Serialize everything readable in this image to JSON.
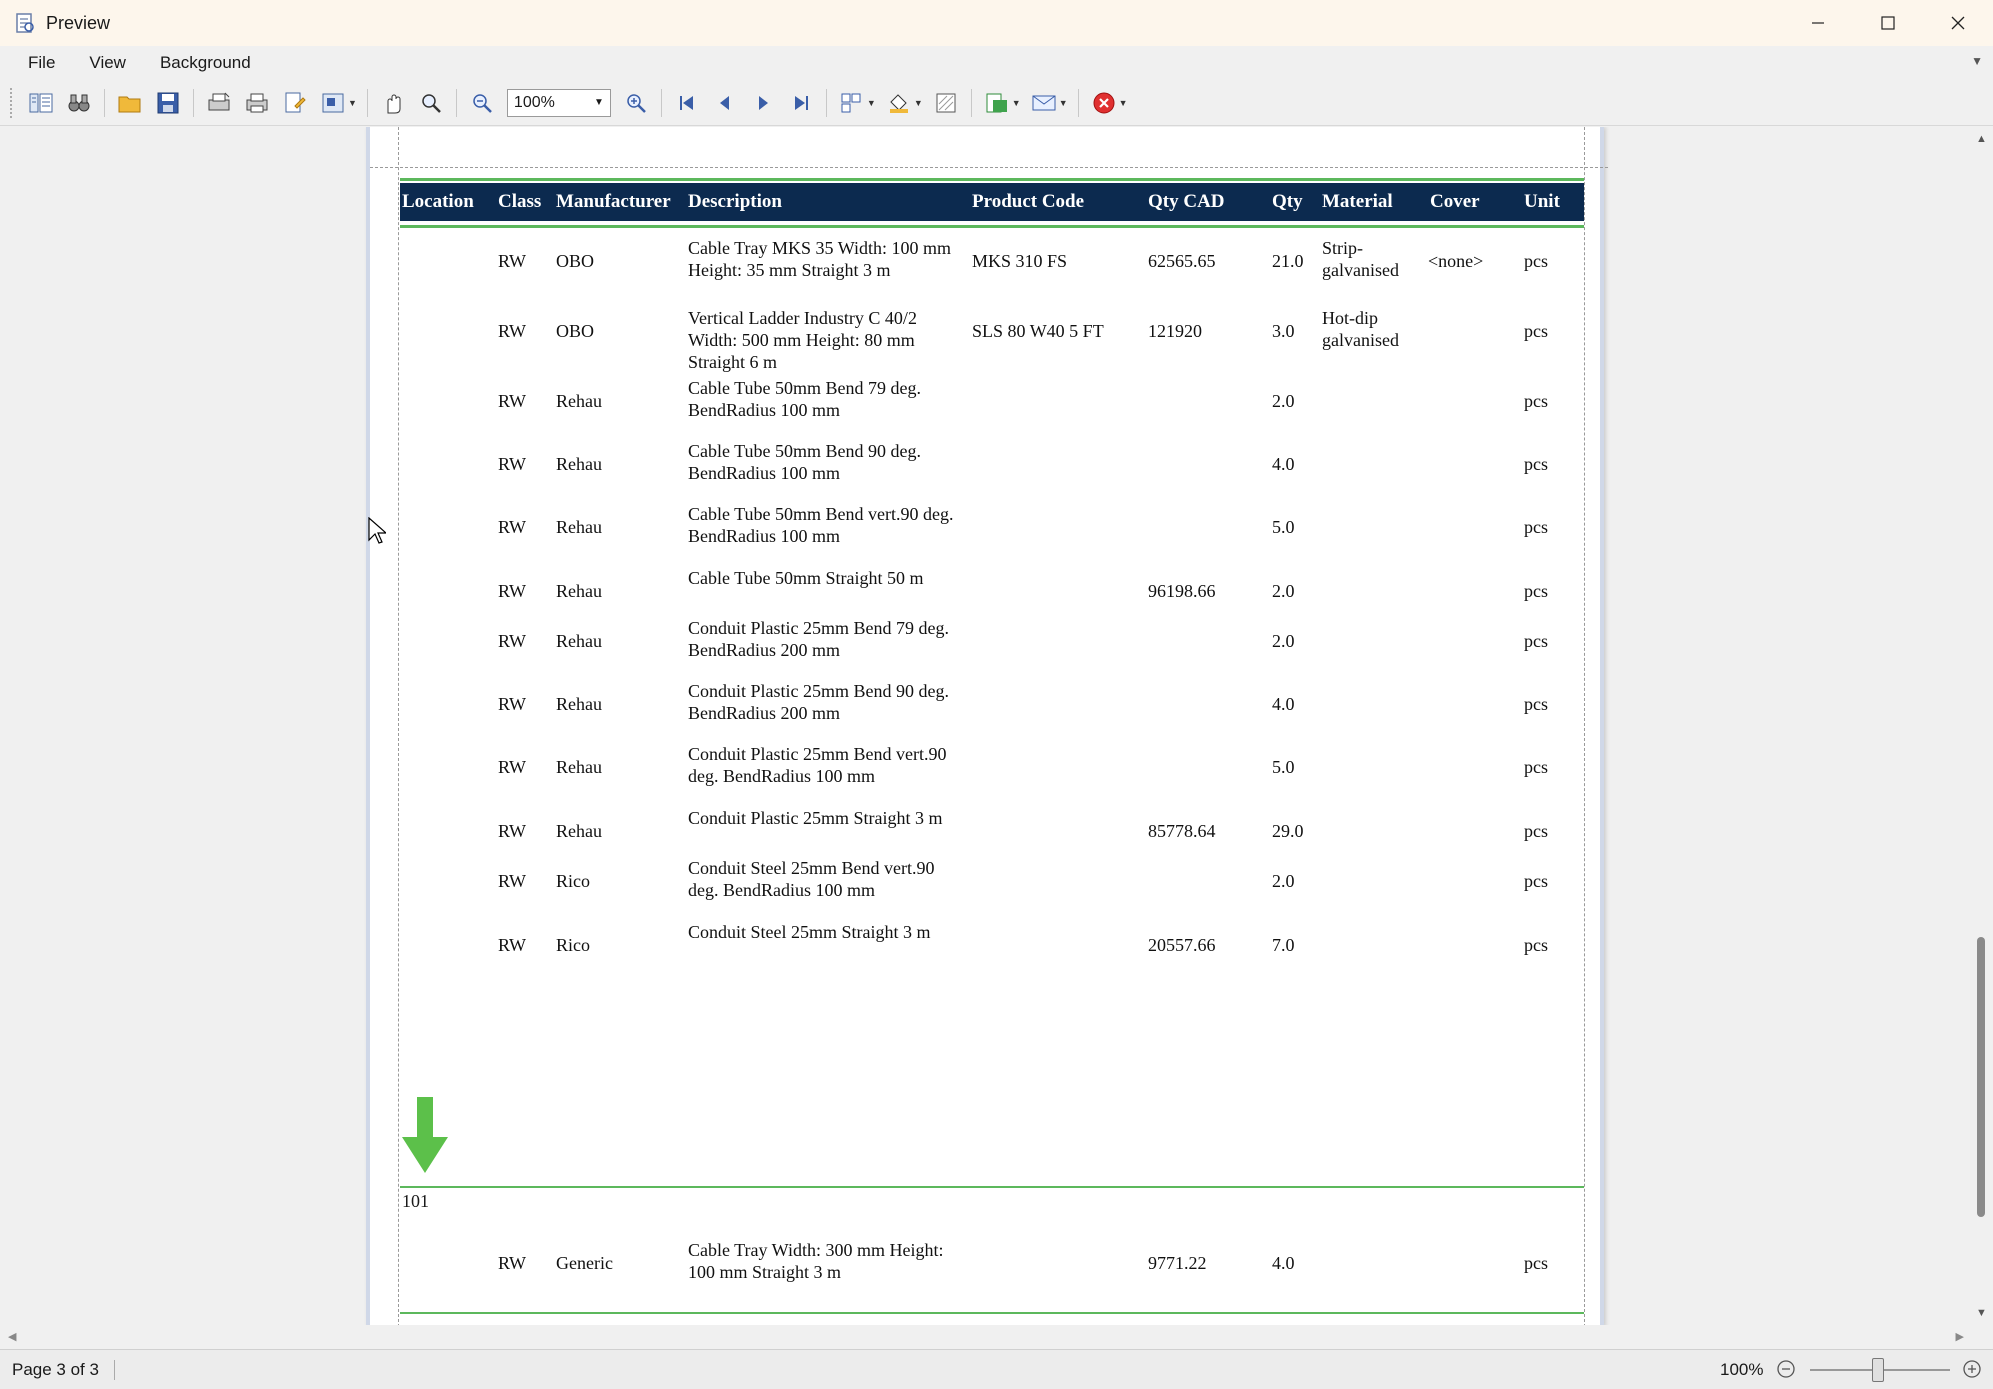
{
  "window": {
    "title": "Preview"
  },
  "menu": {
    "items": [
      "File",
      "View",
      "Background"
    ]
  },
  "toolbar": {
    "zoom_value": "100%"
  },
  "report": {
    "columns": [
      "Location",
      "Class",
      "Manufacturer",
      "Description",
      "Product Code",
      "Qty CAD",
      "Qty",
      "Material",
      "Cover",
      "Unit"
    ],
    "rows": [
      {
        "class": "RW",
        "manufacturer": "OBO",
        "description": "Cable Tray MKS 35 Width: 100 mm Height: 35 mm Straight 3 m",
        "product_code": "MKS 310 FS",
        "qty_cad": "62565.65",
        "qty": "21.0",
        "material": "Strip-galvanised",
        "cover": "<none>",
        "unit": "pcs"
      },
      {
        "class": "RW",
        "manufacturer": "OBO",
        "description": "Vertical Ladder Industry C 40/2 Width: 500 mm Height: 80 mm Straight 6 m",
        "product_code": "SLS 80 W40 5 FT",
        "qty_cad": "121920",
        "qty": "3.0",
        "material": "Hot-dip galvanised",
        "cover": "",
        "unit": "pcs"
      },
      {
        "class": "RW",
        "manufacturer": "Rehau",
        "description": "Cable Tube 50mm Bend 79 deg. BendRadius 100 mm",
        "product_code": "",
        "qty_cad": "",
        "qty": "2.0",
        "material": "",
        "cover": "",
        "unit": "pcs"
      },
      {
        "class": "RW",
        "manufacturer": "Rehau",
        "description": "Cable Tube 50mm Bend 90 deg. BendRadius 100 mm",
        "product_code": "",
        "qty_cad": "",
        "qty": "4.0",
        "material": "",
        "cover": "",
        "unit": "pcs"
      },
      {
        "class": "RW",
        "manufacturer": "Rehau",
        "description": "Cable Tube 50mm Bend vert.90 deg. BendRadius 100 mm",
        "product_code": "",
        "qty_cad": "",
        "qty": "5.0",
        "material": "",
        "cover": "",
        "unit": "pcs"
      },
      {
        "class": "RW",
        "manufacturer": "Rehau",
        "description": "Cable Tube 50mm Straight 50 m",
        "product_code": "",
        "qty_cad": "96198.66",
        "qty": "2.0",
        "material": "",
        "cover": "",
        "unit": "pcs"
      },
      {
        "class": "RW",
        "manufacturer": "Rehau",
        "description": "Conduit Plastic 25mm Bend 79 deg. BendRadius 200 mm",
        "product_code": "",
        "qty_cad": "",
        "qty": "2.0",
        "material": "",
        "cover": "",
        "unit": "pcs"
      },
      {
        "class": "RW",
        "manufacturer": "Rehau",
        "description": "Conduit Plastic 25mm Bend 90 deg. BendRadius 200 mm",
        "product_code": "",
        "qty_cad": "",
        "qty": "4.0",
        "material": "",
        "cover": "",
        "unit": "pcs"
      },
      {
        "class": "RW",
        "manufacturer": "Rehau",
        "description": "Conduit Plastic 25mm Bend vert.90 deg. BendRadius 100 mm",
        "product_code": "",
        "qty_cad": "",
        "qty": "5.0",
        "material": "",
        "cover": "",
        "unit": "pcs"
      },
      {
        "class": "RW",
        "manufacturer": "Rehau",
        "description": "Conduit Plastic 25mm Straight 3 m",
        "product_code": "",
        "qty_cad": "85778.64",
        "qty": "29.0",
        "material": "",
        "cover": "",
        "unit": "pcs"
      },
      {
        "class": "RW",
        "manufacturer": "Rico",
        "description": "Conduit Steel 25mm Bend vert.90 deg. BendRadius 100 mm",
        "product_code": "",
        "qty_cad": "",
        "qty": "2.0",
        "material": "",
        "cover": "",
        "unit": "pcs"
      },
      {
        "class": "RW",
        "manufacturer": "Rico",
        "description": "Conduit Steel 25mm Straight 3 m",
        "product_code": "",
        "qty_cad": "20557.66",
        "qty": "7.0",
        "material": "",
        "cover": "",
        "unit": "pcs"
      }
    ],
    "group_label": "101",
    "group_rows": [
      {
        "class": "RW",
        "manufacturer": "Generic",
        "description": "Cable Tray Width: 300 mm Height: 100 mm Straight 3 m",
        "product_code": "",
        "qty_cad": "9771.22",
        "qty": "4.0",
        "material": "",
        "cover": "",
        "unit": "pcs"
      }
    ]
  },
  "status": {
    "page_info": "Page 3 of 3",
    "zoom": "100%"
  },
  "colors": {
    "header_bg": "#0c2a4f",
    "rule_green": "#5cb85c",
    "arrow_green": "#5cc04a"
  }
}
